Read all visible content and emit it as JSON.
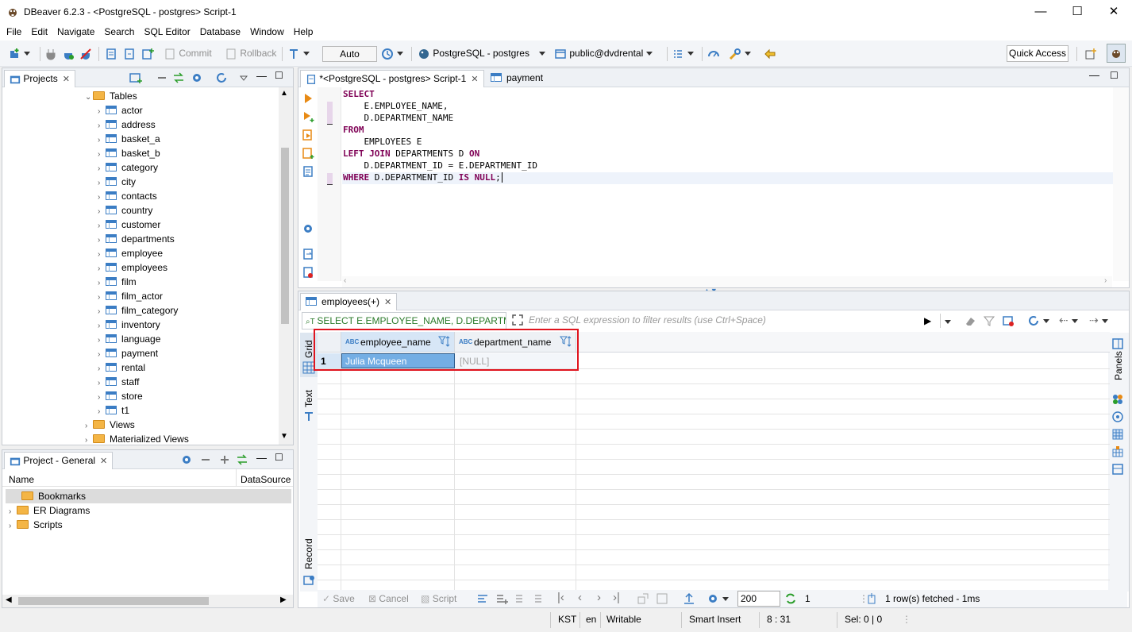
{
  "window": {
    "title": "DBeaver 6.2.3 - <PostgreSQL - postgres> Script-1",
    "minimize": "—",
    "maximize": "☐",
    "close": "✕"
  },
  "menu": [
    "File",
    "Edit",
    "Navigate",
    "Search",
    "SQL Editor",
    "Database",
    "Window",
    "Help"
  ],
  "toolbar": {
    "commit": "Commit",
    "rollback": "Rollback",
    "transaction_mode": "Auto",
    "datasource": "PostgreSQL - postgres",
    "schema": "public@dvdrental",
    "quick_access": "Quick Access"
  },
  "projects_panel": {
    "tab": "Projects",
    "tables_label": "Tables",
    "tables": [
      "actor",
      "address",
      "basket_a",
      "basket_b",
      "category",
      "city",
      "contacts",
      "country",
      "customer",
      "departments",
      "employee",
      "employees",
      "film",
      "film_actor",
      "film_category",
      "inventory",
      "language",
      "payment",
      "rental",
      "staff",
      "store",
      "t1"
    ],
    "views_label": "Views",
    "mviews_label": "Materialized Views"
  },
  "project_general": {
    "tab": "Project - General",
    "col_name": "Name",
    "col_datasource": "DataSource",
    "items": [
      "Bookmarks",
      "ER Diagrams",
      "Scripts"
    ]
  },
  "editor": {
    "tab_active": "*<PostgreSQL - postgres> Script-1",
    "tab_other": "payment",
    "code": [
      {
        "kw": "SELECT",
        "rest": ""
      },
      {
        "kw": "",
        "rest": "    E.EMPLOYEE_NAME,"
      },
      {
        "kw": "",
        "rest": "    D.DEPARTMENT_NAME"
      },
      {
        "kw": "FROM",
        "rest": ""
      },
      {
        "kw": "",
        "rest": "    EMPLOYEES E"
      },
      {
        "kw": "LEFT JOIN",
        "rest": " DEPARTMENTS D "
      },
      {
        "kw": "",
        "rest": "    D.DEPARTMENT_ID = E.DEPARTMENT_ID"
      },
      {
        "kw": "WHERE",
        "rest": " D.DEPARTMENT_ID "
      }
    ],
    "kw_on": "ON",
    "kw_is_null": "IS NULL",
    "semicolon": ";"
  },
  "results": {
    "tab": "employees(+)",
    "query_preview": "SELECT E.EMPLOYEE_NAME, D.DEPARTMEN",
    "filter_placeholder": "Enter a SQL expression to filter results (use Ctrl+Space)",
    "side_grid": "Grid",
    "side_text": "Text",
    "side_record": "Record",
    "side_panels": "Panels",
    "columns": [
      "employee_name",
      "department_name"
    ],
    "col_type_badge": "ABC",
    "row_number": "1",
    "row_values": [
      "Julia Mcqueen",
      "[NULL]"
    ],
    "bottom": {
      "save": "Save",
      "cancel": "Cancel",
      "script": "Script",
      "fetch_size": "200",
      "fetched_count": "1",
      "fetch_status": "1 row(s) fetched - 1ms"
    }
  },
  "statusbar": {
    "timezone": "KST",
    "locale": "en",
    "mode": "Writable",
    "insert_mode": "Smart Insert",
    "cursor": "8 : 31",
    "selection": "Sel: 0 | 0"
  },
  "colors": {
    "highlight_box": "#e0141e",
    "selected_cell": "#74aee4",
    "keyword": "#7f0055",
    "active_line": "#eef3fb"
  }
}
